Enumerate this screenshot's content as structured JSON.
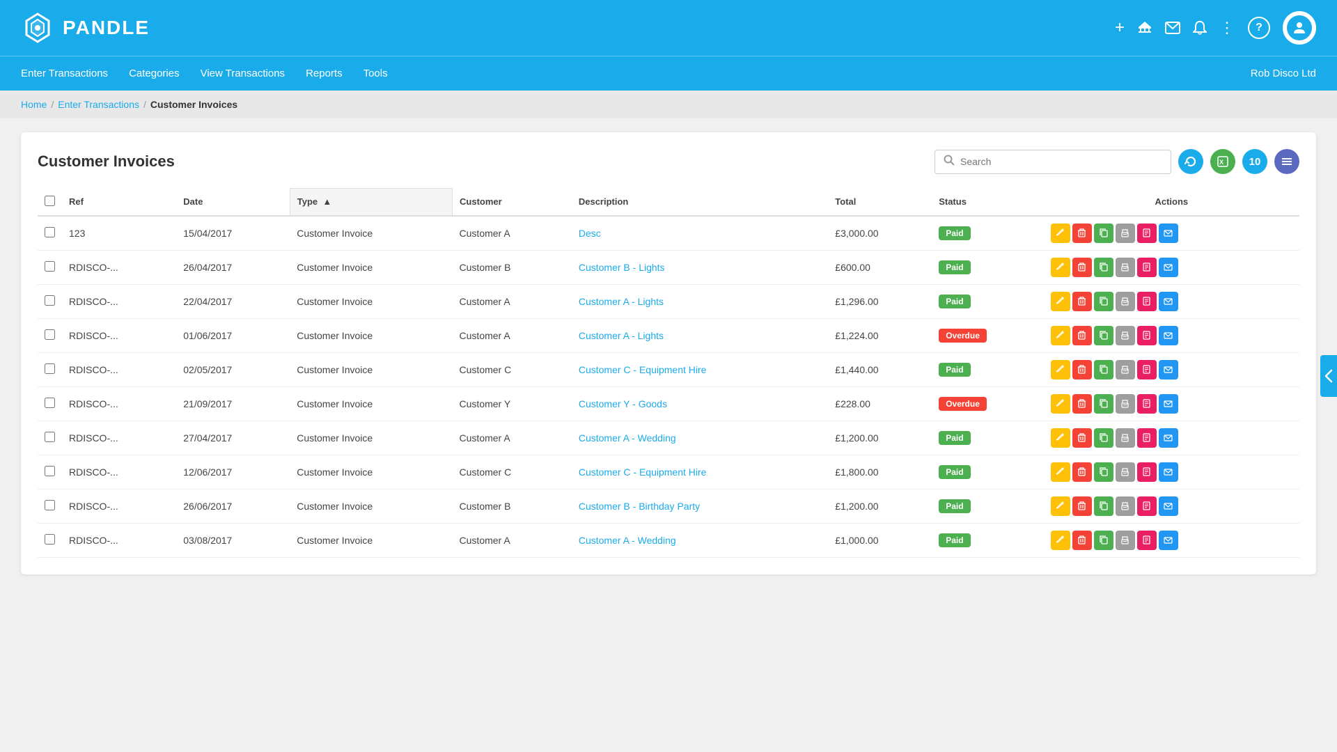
{
  "brand": {
    "name": "PANDLE"
  },
  "header": {
    "icons": {
      "plus": "+",
      "bank": "🏛",
      "mail": "✉",
      "bell": "🔔",
      "more": "⋮",
      "help": "?"
    },
    "company": "Rob Disco Ltd"
  },
  "nav": {
    "links": [
      {
        "label": "Enter Transactions",
        "id": "enter-transactions"
      },
      {
        "label": "Categories",
        "id": "categories"
      },
      {
        "label": "View Transactions",
        "id": "view-transactions"
      },
      {
        "label": "Reports",
        "id": "reports"
      },
      {
        "label": "Tools",
        "id": "tools"
      }
    ]
  },
  "breadcrumb": {
    "home": "Home",
    "enter": "Enter Transactions",
    "current": "Customer Invoices"
  },
  "page": {
    "title": "Customer Invoices"
  },
  "search": {
    "placeholder": "Search"
  },
  "toolbar": {
    "refresh_label": "↻",
    "excel_label": "X",
    "count_label": "10",
    "columns_label": "☰"
  },
  "table": {
    "columns": [
      "Ref",
      "Date",
      "Type",
      "Customer",
      "Description",
      "Total",
      "Status",
      "Actions"
    ],
    "rows": [
      {
        "ref": "123",
        "date": "15/04/2017",
        "type": "Customer Invoice",
        "customer": "Customer A",
        "description": "Desc",
        "total": "£3,000.00",
        "status": "Paid",
        "status_type": "paid"
      },
      {
        "ref": "RDISCO-...",
        "date": "26/04/2017",
        "type": "Customer Invoice",
        "customer": "Customer B",
        "description": "Customer B - Lights",
        "total": "£600.00",
        "status": "Paid",
        "status_type": "paid"
      },
      {
        "ref": "RDISCO-...",
        "date": "22/04/2017",
        "type": "Customer Invoice",
        "customer": "Customer A",
        "description": "Customer A - Lights",
        "total": "£1,296.00",
        "status": "Paid",
        "status_type": "paid"
      },
      {
        "ref": "RDISCO-...",
        "date": "01/06/2017",
        "type": "Customer Invoice",
        "customer": "Customer A",
        "description": "Customer A - Lights",
        "total": "£1,224.00",
        "status": "Overdue",
        "status_type": "overdue"
      },
      {
        "ref": "RDISCO-...",
        "date": "02/05/2017",
        "type": "Customer Invoice",
        "customer": "Customer C",
        "description": "Customer C - Equipment Hire",
        "total": "£1,440.00",
        "status": "Paid",
        "status_type": "paid"
      },
      {
        "ref": "RDISCO-...",
        "date": "21/09/2017",
        "type": "Customer Invoice",
        "customer": "Customer Y",
        "description": "Customer Y - Goods",
        "total": "£228.00",
        "status": "Overdue",
        "status_type": "overdue"
      },
      {
        "ref": "RDISCO-...",
        "date": "27/04/2017",
        "type": "Customer Invoice",
        "customer": "Customer A",
        "description": "Customer A - Wedding",
        "total": "£1,200.00",
        "status": "Paid",
        "status_type": "paid"
      },
      {
        "ref": "RDISCO-...",
        "date": "12/06/2017",
        "type": "Customer Invoice",
        "customer": "Customer C",
        "description": "Customer C - Equipment Hire",
        "total": "£1,800.00",
        "status": "Paid",
        "status_type": "paid"
      },
      {
        "ref": "RDISCO-...",
        "date": "26/06/2017",
        "type": "Customer Invoice",
        "customer": "Customer B",
        "description": "Customer B - Birthday Party",
        "total": "£1,200.00",
        "status": "Paid",
        "status_type": "paid"
      },
      {
        "ref": "RDISCO-...",
        "date": "03/08/2017",
        "type": "Customer Invoice",
        "customer": "Customer A",
        "description": "Customer A - Wedding",
        "total": "£1,000.00",
        "status": "Paid",
        "status_type": "paid"
      }
    ]
  }
}
